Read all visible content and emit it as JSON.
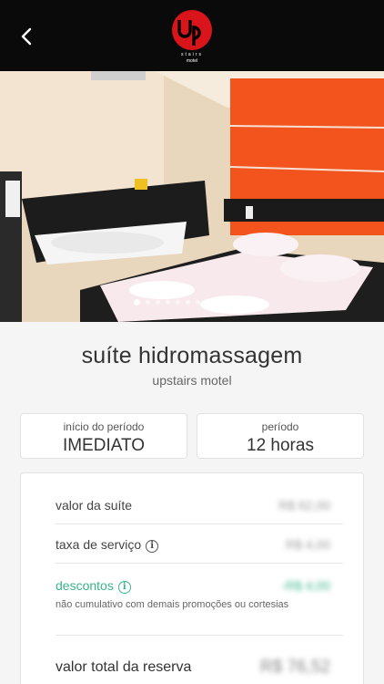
{
  "header": {
    "back_icon": "chevron-left-icon",
    "logo_text": "up",
    "logo_subtext": "stairs",
    "logo_caption": "motel",
    "brand_color": "#d9151b"
  },
  "gallery": {
    "image_count": 12,
    "active_index": 0
  },
  "room": {
    "name": "suíte hidromassagem",
    "motel": "upstairs motel"
  },
  "period_start": {
    "label": "início do período",
    "value": "IMEDIATO"
  },
  "period": {
    "label": "período",
    "value": "12 horas"
  },
  "pricing": {
    "room_label": "valor da suíte",
    "room_value": "R$ 62,00",
    "service_label": "taxa de serviço",
    "service_value": "R$ 4,00",
    "discount_label": "descontos",
    "discount_value": "-R$ 4,00",
    "discount_note": "não cumulativo com demais promoções ou cortesias",
    "total_label": "valor total da reserva",
    "total_value": "R$ 76,52",
    "accent_color": "#39b58a"
  }
}
